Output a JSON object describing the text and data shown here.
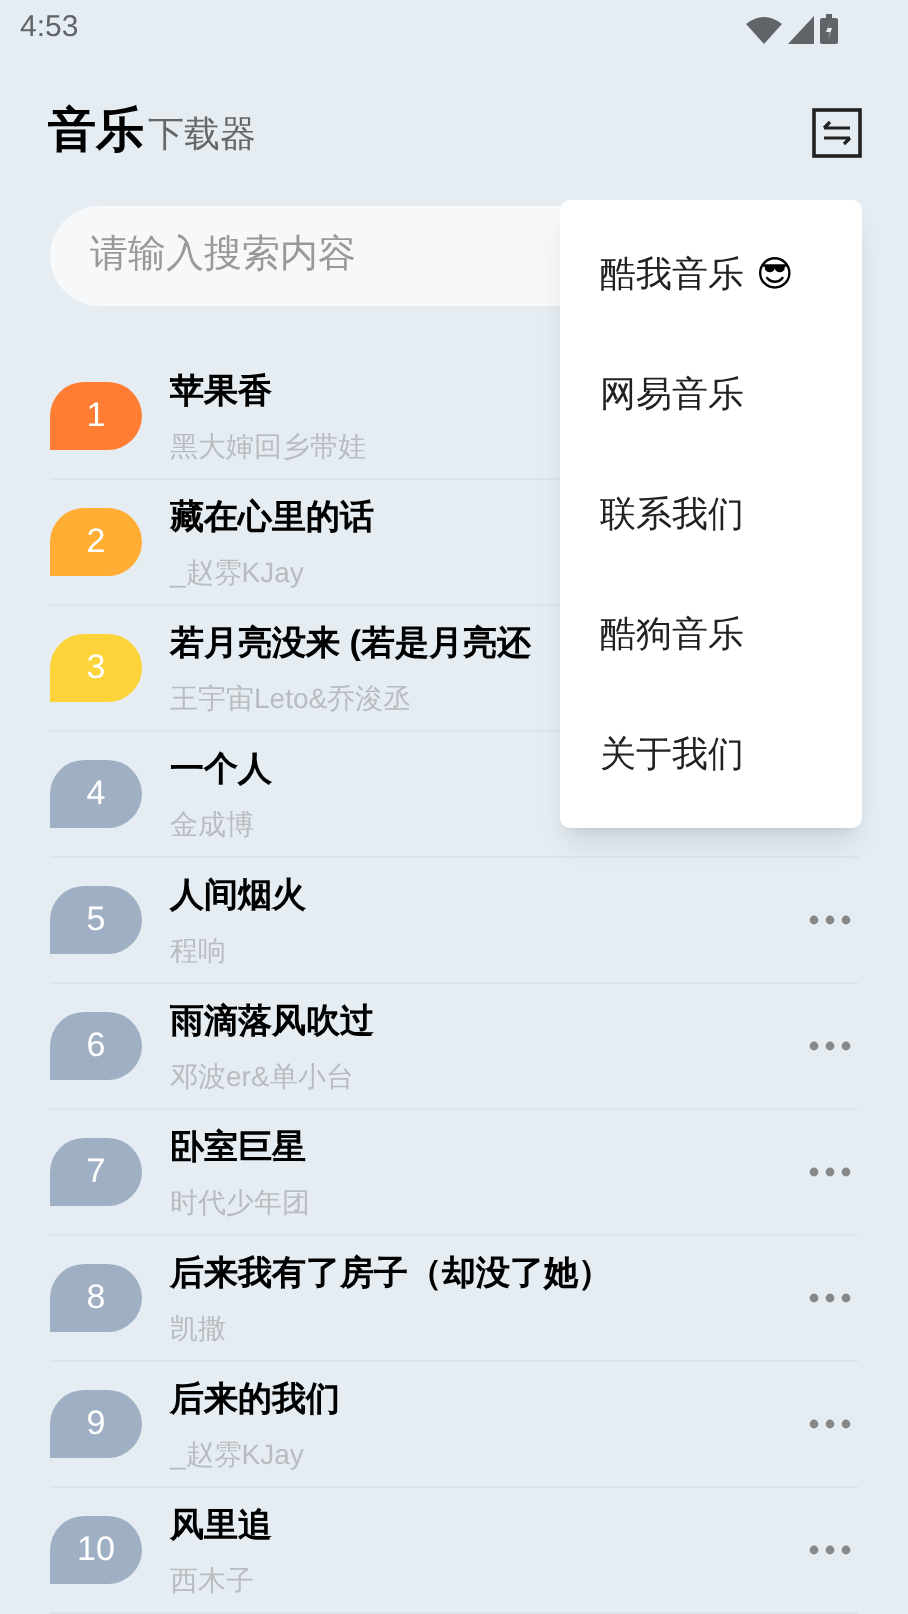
{
  "status_bar": {
    "time": "4:53"
  },
  "header": {
    "title": "音乐",
    "subtitle": "下载器"
  },
  "search": {
    "placeholder": "请输入搜索内容"
  },
  "songs": [
    {
      "rank": "1",
      "title": "苹果香",
      "artist": "黑大婶回乡带娃",
      "color": "#ff7d33"
    },
    {
      "rank": "2",
      "title": "藏在心里的话",
      "artist": "_赵雰KJay",
      "color": "#ffad33"
    },
    {
      "rank": "3",
      "title": "若月亮没来 (若是月亮还",
      "artist": "王宇宙Leto&乔浚丞",
      "color": "#fdd33a"
    },
    {
      "rank": "4",
      "title": "一个人",
      "artist": "金成博",
      "color": "#9fb0c5"
    },
    {
      "rank": "5",
      "title": "人间烟火",
      "artist": "程响",
      "color": "#9fb0c5"
    },
    {
      "rank": "6",
      "title": "雨滴落风吹过",
      "artist": "邓波er&单小台",
      "color": "#9fb0c5"
    },
    {
      "rank": "7",
      "title": "卧室巨星",
      "artist": "时代少年团",
      "color": "#9fb0c5"
    },
    {
      "rank": "8",
      "title": "后来我有了房子（却没了她）",
      "artist": "凯撒",
      "color": "#9fb0c5"
    },
    {
      "rank": "9",
      "title": "后来的我们",
      "artist": "_赵雰KJay",
      "color": "#9fb0c5"
    },
    {
      "rank": "10",
      "title": "风里追",
      "artist": "西木子",
      "color": "#9fb0c5"
    }
  ],
  "menu": {
    "items": [
      {
        "label": "酷我音乐",
        "emoji": "😎"
      },
      {
        "label": "网易音乐"
      },
      {
        "label": "联系我们"
      },
      {
        "label": "酷狗音乐"
      },
      {
        "label": "关于我们"
      }
    ]
  }
}
